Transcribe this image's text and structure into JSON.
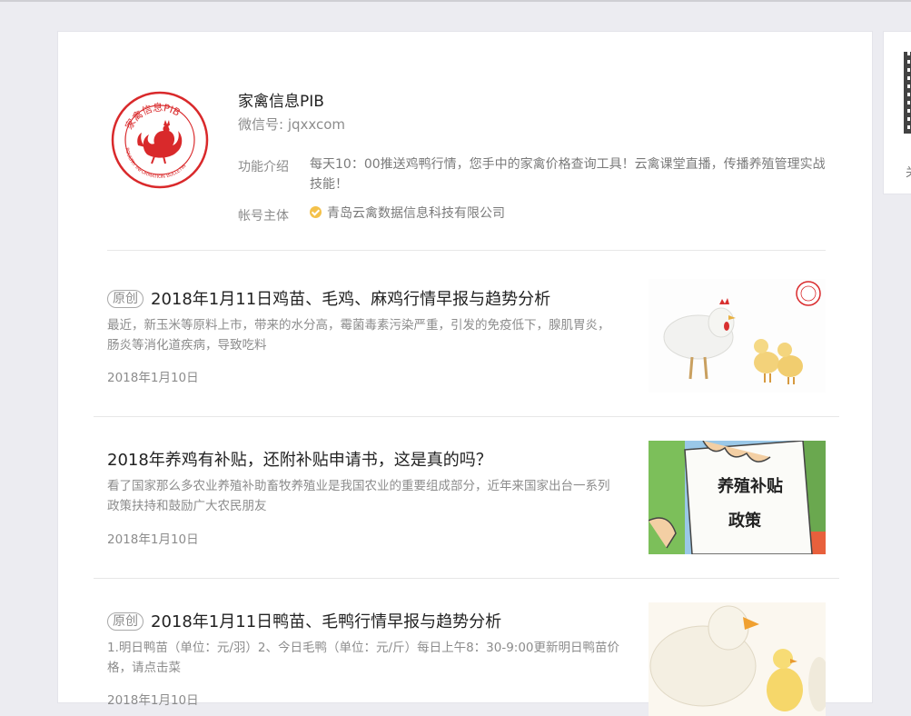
{
  "account": {
    "name": "家禽信息PIB",
    "wechat_id": "微信号: jqxxcom",
    "intro_label": "功能介绍",
    "intro_text": "每天10：00推送鸡鸭行情，您手中的家禽价格查询工具！云禽课堂直播，传播养殖管理实战技能！",
    "owner_label": "帐号主体",
    "owner_text": "青岛云禽数据信息科技有限公司",
    "logo": {
      "icon": "rooster-seal-logo",
      "top_text": "家禽信息PIB",
      "bottom_text": "POULTRY INFORMATION BULLETIN",
      "color": "#d9292b"
    }
  },
  "side_panel": {
    "icon": "qr-code-icon",
    "caption": "关"
  },
  "articles": [
    {
      "tag": "原创",
      "title": "2018年1月11日鸡苗、毛鸡、麻鸡行情早报与趋势分析",
      "desc": "最近，新玉米等原料上市，带来的水分高，霉菌毒素污染严重，引发的免疫低下，腺肌胃炎，肠炎等消化道疾病，导致吃料",
      "date": "2018年1月10日",
      "thumb": "rooster-and-chicks-image"
    },
    {
      "tag": "",
      "title": "2018年养鸡有补贴，还附补贴申请书，这是真的吗？",
      "desc": "看了国家那么多农业养殖补助畜牧养殖业是我国农业的重要组成部分，近年来国家出台一系列政策扶持和鼓励广大农民朋友",
      "date": "2018年1月10日",
      "thumb": "subsidy-policy-image",
      "thumb_text_1": "养殖补贴",
      "thumb_text_2": "政策"
    },
    {
      "tag": "原创",
      "title": "2018年1月11日鸭苗、毛鸭行情早报与趋势分析",
      "desc": "1.明日鸭苗（单位：元/羽）2、今日毛鸭（单位：元/斤）每日上午8：30-9:00更新明日鸭苗价格，请点击菜",
      "date": "2018年1月10日",
      "thumb": "ducks-image"
    }
  ]
}
